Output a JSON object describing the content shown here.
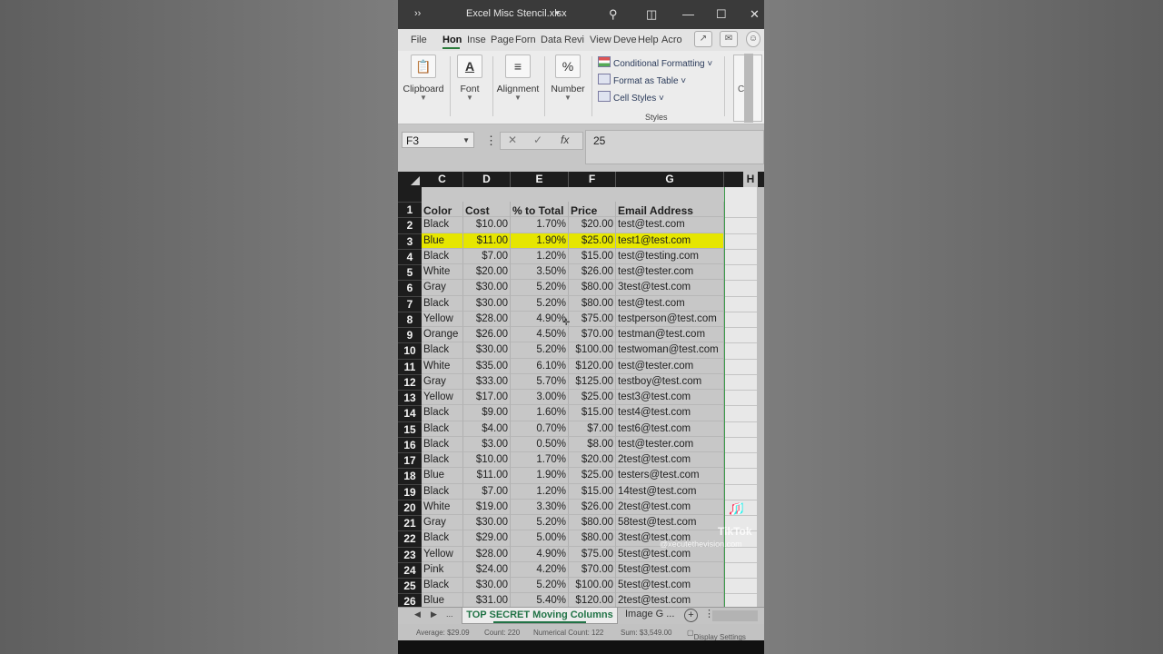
{
  "titlebar": {
    "title": "Excel Misc Stencil.xlsx",
    "icons": [
      "search-icon",
      "ribbon-display-icon",
      "minimize-icon",
      "maximize-icon",
      "close-icon"
    ]
  },
  "ribbon": {
    "tabs": [
      "File",
      "Hon",
      "Inse",
      "Page",
      "Forn",
      "Data",
      "Revi",
      "View",
      "Deve",
      "Help",
      "Acro"
    ],
    "active_tab": "Hon",
    "groups": {
      "clipboard": "Clipboard",
      "font": "Font",
      "alignment": "Alignment",
      "number": "Number",
      "number_glyph": "%",
      "font_glyph": "A",
      "cells_partial": "Ce"
    },
    "styles": {
      "conditional": "Conditional Formatting",
      "format_table": "Format as Table",
      "cell_styles": "Cell Styles",
      "label": "Styles"
    }
  },
  "formula_bar": {
    "name_box": "F3",
    "content": "25",
    "fx": "fx"
  },
  "sheet": {
    "columns": [
      "C",
      "D",
      "E",
      "F",
      "G",
      "H"
    ],
    "header_row": [
      "Color",
      "Cost",
      "% to Total",
      "Price",
      "Email Address"
    ],
    "row_numbers": [
      "1",
      "2",
      "3",
      "4",
      "5",
      "6",
      "7",
      "8",
      "9",
      "10",
      "11",
      "12",
      "13",
      "14",
      "15",
      "16",
      "17",
      "18",
      "19",
      "20",
      "21",
      "22",
      "23",
      "24",
      "25",
      "26"
    ],
    "selected_row": 3,
    "rows": [
      [
        "Black",
        "$10.00",
        "1.70%",
        "$20.00",
        "test@test.com"
      ],
      [
        "Blue",
        "$11.00",
        "1.90%",
        "$25.00",
        "test1@test.com"
      ],
      [
        "Black",
        "$7.00",
        "1.20%",
        "$15.00",
        "test@testing.com"
      ],
      [
        "White",
        "$20.00",
        "3.50%",
        "$26.00",
        "test@tester.com"
      ],
      [
        "Gray",
        "$30.00",
        "5.20%",
        "$80.00",
        "3test@test.com"
      ],
      [
        "Black",
        "$30.00",
        "5.20%",
        "$80.00",
        "test@test.com"
      ],
      [
        "Yellow",
        "$28.00",
        "4.90%",
        "$75.00",
        "testperson@test.com"
      ],
      [
        "Orange",
        "$26.00",
        "4.50%",
        "$70.00",
        "testman@test.com"
      ],
      [
        "Black",
        "$30.00",
        "5.20%",
        "$100.00",
        "testwoman@test.com"
      ],
      [
        "White",
        "$35.00",
        "6.10%",
        "$120.00",
        "test@tester.com"
      ],
      [
        "Gray",
        "$33.00",
        "5.70%",
        "$125.00",
        "testboy@test.com"
      ],
      [
        "Yellow",
        "$17.00",
        "3.00%",
        "$25.00",
        "test3@test.com"
      ],
      [
        "Black",
        "$9.00",
        "1.60%",
        "$15.00",
        "test4@test.com"
      ],
      [
        "Black",
        "$4.00",
        "0.70%",
        "$7.00",
        "test6@test.com"
      ],
      [
        "Black",
        "$3.00",
        "0.50%",
        "$8.00",
        "test@tester.com"
      ],
      [
        "Black",
        "$10.00",
        "1.70%",
        "$20.00",
        "2test@test.com"
      ],
      [
        "Blue",
        "$11.00",
        "1.90%",
        "$25.00",
        "testers@test.com"
      ],
      [
        "Black",
        "$7.00",
        "1.20%",
        "$15.00",
        "14test@test.com"
      ],
      [
        "White",
        "$19.00",
        "3.30%",
        "$26.00",
        "2test@test.com"
      ],
      [
        "Gray",
        "$30.00",
        "5.20%",
        "$80.00",
        "58test@test.com"
      ],
      [
        "Black",
        "$29.00",
        "5.00%",
        "$80.00",
        "3test@test.com"
      ],
      [
        "Yellow",
        "$28.00",
        "4.90%",
        "$75.00",
        "5test@test.com"
      ],
      [
        "Pink",
        "$24.00",
        "4.20%",
        "$70.00",
        "5test@test.com"
      ],
      [
        "Black",
        "$30.00",
        "5.20%",
        "$100.00",
        "5test@test.com"
      ],
      [
        "Blue",
        "$31.00",
        "5.40%",
        "$120.00",
        "2test@test.com"
      ]
    ]
  },
  "sheet_tabs": {
    "active": "TOP SECRET Moving Columns",
    "other": "Image G ...",
    "ellipsis": "..."
  },
  "status": {
    "average": "Average: $29.09",
    "count": "Count: 220",
    "numerical_count": "Numerical Count: 122",
    "sum": "Sum: $3,549.00",
    "display_settings": "Display Settings"
  },
  "watermark": {
    "brand": "TikTok",
    "handle": "@xecutethevision.com"
  },
  "colors": {
    "highlight": "#e6e600",
    "excel_green": "#217346",
    "header_dark": "#1d1d1d"
  }
}
